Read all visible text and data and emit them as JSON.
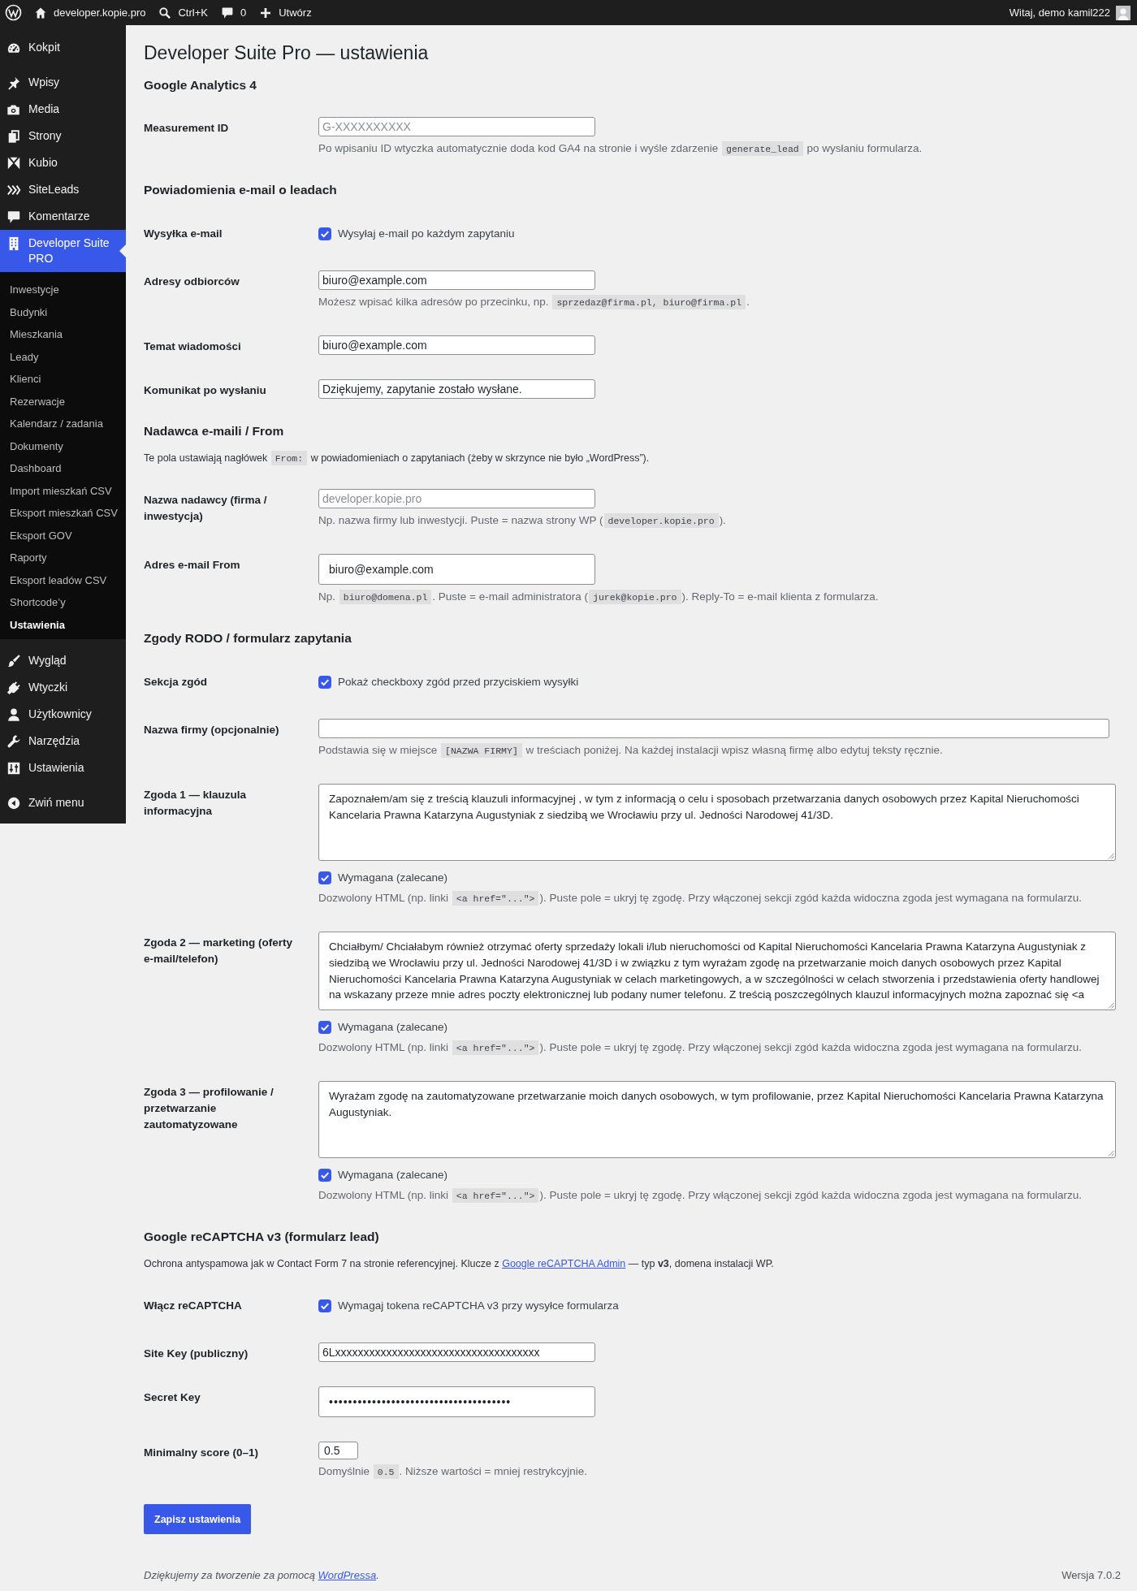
{
  "admin_bar": {
    "site_name": "developer.kopie.pro",
    "search_shortcut": "Ctrl+K",
    "comments_count": "0",
    "new_label": "Utwórz",
    "greeting": "Witaj, demo kamil222"
  },
  "sidebar": {
    "groups": [
      {
        "items": [
          {
            "label": "Kokpit",
            "selected": false
          }
        ]
      },
      {
        "items": [
          {
            "label": "Wpisy",
            "selected": false
          },
          {
            "label": "Media",
            "selected": false
          },
          {
            "label": "Strony",
            "selected": false
          },
          {
            "label": "Kubio",
            "selected": false
          },
          {
            "label": "SiteLeads",
            "selected": false
          },
          {
            "label": "Komentarze",
            "selected": false
          },
          {
            "label": "Developer Suite PRO",
            "selected": true,
            "children": [
              {
                "label": "Inwestycje",
                "selected": false
              },
              {
                "label": "Budynki",
                "selected": false
              },
              {
                "label": "Mieszkania",
                "selected": false
              },
              {
                "label": "Leady",
                "selected": false
              },
              {
                "label": "Klienci",
                "selected": false
              },
              {
                "label": "Rezerwacje",
                "selected": false
              },
              {
                "label": "Kalendarz / zadania",
                "selected": false
              },
              {
                "label": "Dokumenty",
                "selected": false
              },
              {
                "label": "Dashboard",
                "selected": false
              },
              {
                "label": "Import mieszkań CSV",
                "selected": false
              },
              {
                "label": "Eksport mieszkań CSV",
                "selected": false
              },
              {
                "label": "Eksport GOV",
                "selected": false
              },
              {
                "label": "Raporty",
                "selected": false
              },
              {
                "label": "Eksport leadów CSV",
                "selected": false
              },
              {
                "label": "Shortcode’y",
                "selected": false
              },
              {
                "label": "Ustawienia",
                "selected": true
              }
            ]
          }
        ]
      },
      {
        "items": [
          {
            "label": "Wygląd",
            "selected": false
          },
          {
            "label": "Wtyczki",
            "selected": false
          },
          {
            "label": "Użytkownicy",
            "selected": false
          },
          {
            "label": "Narzędzia",
            "selected": false
          },
          {
            "label": "Ustawienia",
            "selected": false
          }
        ]
      }
    ],
    "collapse_label": "Zwiń menu"
  },
  "page": {
    "title": "Developer Suite Pro — ustawienia",
    "sections": [
      {
        "heading": "Google Analytics 4",
        "fields": [
          {
            "kind": "text",
            "label": "Measurement ID",
            "placeholder": "G-XXXXXXXXXX",
            "description": [
              {
                "kind": "text",
                "text": "Po wpisaniu ID wtyczka automatycznie doda kod GA4 na stronie i wyśle zdarzenie "
              },
              {
                "kind": "code",
                "text": "generate_lead"
              },
              {
                "kind": "text",
                "text": " po wysłaniu formularza."
              }
            ]
          }
        ]
      },
      {
        "heading": "Powiadomienia e-mail o leadach",
        "fields": [
          {
            "kind": "checkbox",
            "label": "Wysyłka e-mail",
            "option": "Wysyłaj e-mail po każdym zapytaniu",
            "checked": true
          },
          {
            "kind": "text",
            "label": "Adresy odbiorców",
            "value": "biuro@example.com",
            "description": [
              {
                "kind": "text",
                "text": "Możesz wpisać kilka adresów po przecinku, np. "
              },
              {
                "kind": "code",
                "text": "sprzedaz@firma.pl, biuro@firma.pl"
              },
              {
                "kind": "text",
                "text": "."
              }
            ]
          },
          {
            "kind": "text",
            "label": "Temat wiadomości",
            "value": "biuro@example.com"
          },
          {
            "kind": "text",
            "label": "Komunikat po wysłaniu",
            "value": "Dziękujemy, zapytanie zostało wysłane."
          }
        ]
      },
      {
        "heading": "Nadawca e-maili / From",
        "intro": [
          {
            "kind": "text",
            "text": "Te pola ustawiają nagłówek "
          },
          {
            "kind": "code",
            "text": "From:"
          },
          {
            "kind": "text",
            "text": " w powiadomieniach o zapytaniach (żeby w skrzynce nie było „WordPress”)."
          }
        ],
        "fields": [
          {
            "kind": "text",
            "label": "Nazwa nadawcy (firma / inwestycja)",
            "placeholder": "developer.kopie.pro",
            "description": [
              {
                "kind": "text",
                "text": "Np. nazwa firmy lub inwestycji. Puste = nazwa strony WP ("
              },
              {
                "kind": "code",
                "text": "developer.kopie.pro"
              },
              {
                "kind": "text",
                "text": ")."
              }
            ]
          },
          {
            "kind": "email",
            "label": "Adres e-mail From",
            "value": "biuro@example.com",
            "description": [
              {
                "kind": "text",
                "text": "Np. "
              },
              {
                "kind": "code",
                "text": "biuro@domena.pl"
              },
              {
                "kind": "text",
                "text": ". Puste = e-mail administratora ("
              },
              {
                "kind": "code",
                "text": "jurek@kopie.pro"
              },
              {
                "kind": "text",
                "text": "). Reply-To = e-mail klienta z formularza."
              }
            ]
          }
        ]
      },
      {
        "heading": "Zgody RODO / formularz zapytania",
        "fields": [
          {
            "kind": "checkbox",
            "label": "Sekcja zgód",
            "option": "Pokaż checkboxy zgód przed przyciskiem wysyłki",
            "checked": true
          },
          {
            "kind": "wide",
            "label": "Nazwa firmy (opcjonalnie)",
            "description": [
              {
                "kind": "text",
                "text": "Podstawia się w miejsce "
              },
              {
                "kind": "code",
                "text": "[NAZWA FIRMY]"
              },
              {
                "kind": "text",
                "text": " w treściach poniżej. Na każdej instalacji wpisz własną firmę albo edytuj teksty ręcznie."
              }
            ]
          },
          {
            "kind": "textarea",
            "label": "Zgoda 1 — klauzula informacyjna",
            "value": "Zapoznałem/am się z treścią klauzuli informacyjnej , w tym z informacją o celu i sposobach przetwarzania danych osobowych przez Kapital Nieruchomości Kancelaria Prawna Katarzyna Augustyniak z siedzibą we Wrocławiu przy ul. Jedności Narodowej 41/3D.",
            "checkbox": {
              "label": "Wymagana (zalecane)",
              "checked": true
            },
            "description": [
              {
                "kind": "text",
                "text": "Dozwolony HTML (np. linki "
              },
              {
                "kind": "code",
                "text": "<a href=\"...\">"
              },
              {
                "kind": "text",
                "text": "). Puste pole = ukryj tę zgodę. Przy włączonej sekcji zgód każda widoczna zgoda jest wymagana na formularzu."
              }
            ]
          },
          {
            "kind": "textarea",
            "label": "Zgoda 2 — marketing (oferty e-mail/telefon)",
            "value": "Chciałbym/ Chciałabym również otrzymać oferty sprzedaży lokali i/lub nieruchomości od Kapital Nieruchomości Kancelaria Prawna Katarzyna Augustyniak z siedzibą we Wrocławiu przy ul. Jedności Narodowej 41/3D i w związku z tym wyrażam zgodę na przetwarzanie moich danych osobowych przez Kapital Nieruchomości Kancelaria Prawna Katarzyna Augustyniak w celach marketingowych, a w szczególności w celach stworzenia i przedstawienia oferty handlowej na wskazany przeze mnie adres poczty elektronicznej lub podany numer telefonu. Z treścią poszczególnych klauzul informacyjnych można zapoznać się <a",
            "checkbox": {
              "label": "Wymagana (zalecane)",
              "checked": true
            },
            "description": [
              {
                "kind": "text",
                "text": "Dozwolony HTML (np. linki "
              },
              {
                "kind": "code",
                "text": "<a href=\"...\">"
              },
              {
                "kind": "text",
                "text": "). Puste pole = ukryj tę zgodę. Przy włączonej sekcji zgód każda widoczna zgoda jest wymagana na formularzu."
              }
            ]
          },
          {
            "kind": "textarea",
            "label": "Zgoda 3 — profilowanie / przetwarzanie zautomatyzowane",
            "value": "Wyrażam zgodę na zautomatyzowane przetwarzanie moich danych osobowych, w tym profilowanie, przez Kapital Nieruchomości Kancelaria Prawna Katarzyna Augustyniak.",
            "checkbox": {
              "label": "Wymagana (zalecane)",
              "checked": true
            },
            "description": [
              {
                "kind": "text",
                "text": "Dozwolony HTML (np. linki "
              },
              {
                "kind": "code",
                "text": "<a href=\"...\">"
              },
              {
                "kind": "text",
                "text": "). Puste pole = ukryj tę zgodę. Przy włączonej sekcji zgód każda widoczna zgoda jest wymagana na formularzu."
              }
            ]
          }
        ]
      },
      {
        "heading": "Google reCAPTCHA v3 (formularz lead)",
        "intro": [
          {
            "kind": "text",
            "text": "Ochrona antyspamowa jak w Contact Form 7 na stronie referencyjnej. Klucze z "
          },
          {
            "kind": "link",
            "text": "Google reCAPTCHA Admin"
          },
          {
            "kind": "text",
            "text": " — typ **v3**, domena instalacji WP."
          }
        ],
        "fields": [
          {
            "kind": "checkbox",
            "label": "Włącz reCAPTCHA",
            "option": "Wymagaj tokena reCAPTCHA v3 przy wysyłce formularza",
            "checked": true
          },
          {
            "kind": "text",
            "label": "Site Key (publiczny)",
            "value": "6Lxxxxxxxxxxxxxxxxxxxxxxxxxxxxxxxxxxxx"
          },
          {
            "kind": "password",
            "label": "Secret Key",
            "value": "••••••••••••••••••••••••••••••••••••••"
          },
          {
            "kind": "number",
            "label": "Minimalny score (0–1)",
            "value": "0.5",
            "description": [
              {
                "kind": "text",
                "text": "Domyślnie "
              },
              {
                "kind": "code",
                "text": "0.5"
              },
              {
                "kind": "text",
                "text": ". Niższe wartości = mniej restrykcyjnie."
              }
            ]
          }
        ]
      }
    ],
    "submit_label": "Zapisz ustawienia"
  },
  "footer": {
    "credit": [
      {
        "kind": "text",
        "text": "Dziękujemy za tworzenie za pomocą "
      },
      {
        "kind": "link",
        "text": "WordPressa"
      },
      {
        "kind": "text",
        "text": "."
      }
    ],
    "version": "Wersja 7.0.2"
  }
}
